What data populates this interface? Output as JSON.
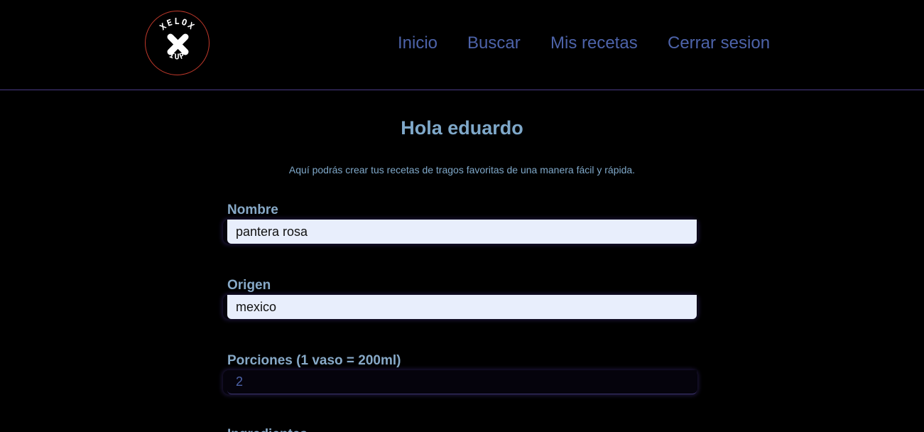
{
  "header": {
    "logo_top_text": "XELOX",
    "logo_bottom_text": "IUP",
    "nav": [
      {
        "label": "Inicio"
      },
      {
        "label": "Buscar"
      },
      {
        "label": "Mis recetas"
      },
      {
        "label": "Cerrar sesion"
      }
    ],
    "nav_color": "#4d63a9",
    "border_color": "#4b3b86"
  },
  "main": {
    "greeting": "Hola eduardo",
    "subtitle": "Aquí podrás crear tus recetas de tragos favoritas de una manera fácil y rápida.",
    "fields": [
      {
        "label": "Nombre",
        "value": "pantera rosa"
      },
      {
        "label": "Origen",
        "value": "mexico"
      },
      {
        "label": "Porciones (1 vaso = 200ml)",
        "value": "2"
      }
    ],
    "next_label_cutoff": "Ingredientes"
  },
  "colors": {
    "background": "#000000",
    "heading": "#7fa8c9",
    "input_fill": "#e8eefc"
  }
}
